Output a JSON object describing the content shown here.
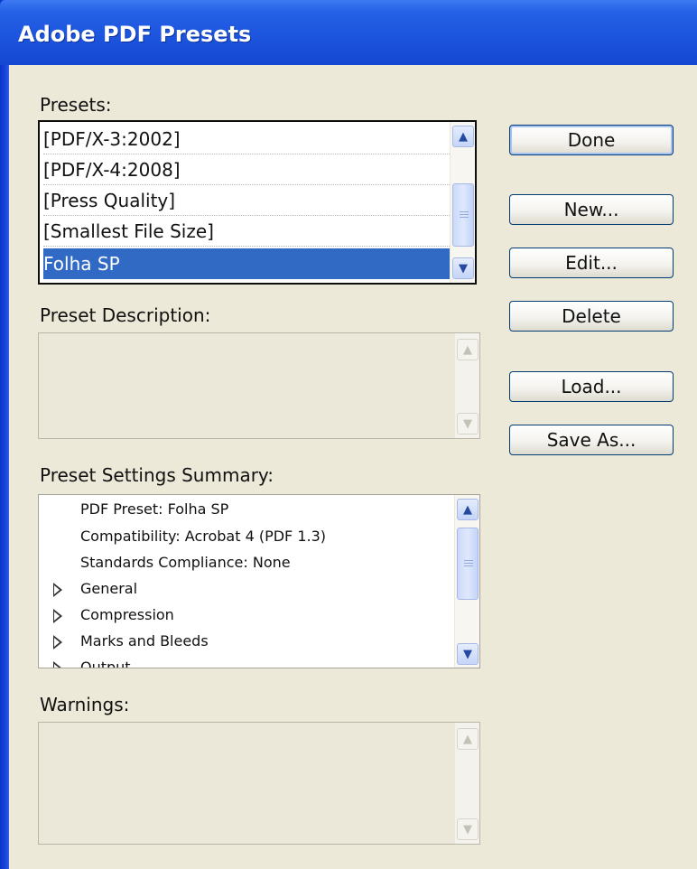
{
  "window": {
    "title": "Adobe PDF Presets"
  },
  "presets": {
    "label": "Presets:",
    "items": [
      "[PDF/X-3:2002]",
      "[PDF/X-4:2008]",
      "[Press Quality]",
      "[Smallest File Size]",
      "Folha SP"
    ],
    "selected": "Folha SP"
  },
  "description": {
    "label": "Preset Description:",
    "text": ""
  },
  "summary": {
    "label": "Preset Settings Summary:",
    "lines": [
      "PDF Preset: Folha SP",
      "Compatibility: Acrobat 4 (PDF 1.3)",
      "Standards Compliance: None"
    ],
    "sections": [
      "General",
      "Compression",
      "Marks and Bleeds",
      "Output"
    ]
  },
  "warnings": {
    "label": "Warnings:",
    "text": ""
  },
  "buttons": {
    "done": "Done",
    "new": "New...",
    "edit": "Edit...",
    "delete": "Delete",
    "load": "Load...",
    "save_as": "Save As..."
  },
  "icons": {
    "scroll_up": "chevron-up-icon",
    "scroll_down": "chevron-down-icon",
    "expand": "triangle-right-icon"
  },
  "colors": {
    "titlebar": "#2461e6",
    "selection": "#316ac5",
    "dialog_bg": "#ece9d8"
  }
}
